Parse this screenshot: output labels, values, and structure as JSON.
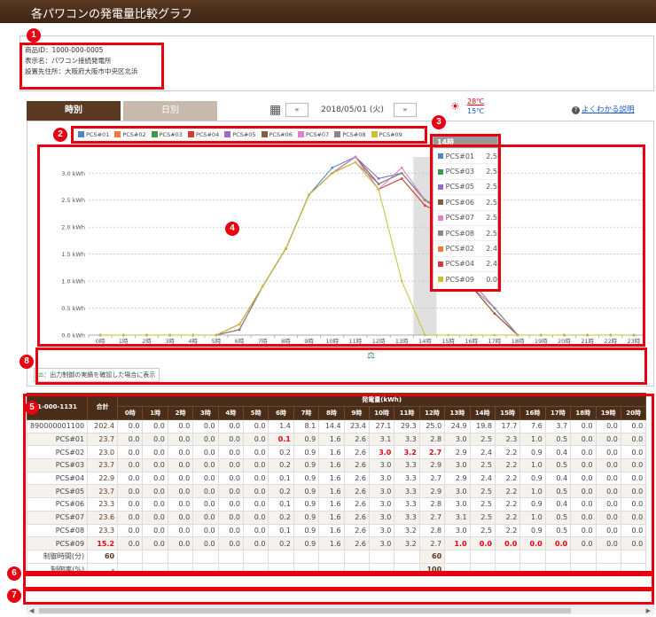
{
  "header": {
    "title": "各パワコンの発電量比較グラフ"
  },
  "info": {
    "product_id": "商品ID：1000-000-0005",
    "display_name": "表示名：パワコン接続発電所",
    "location": "設置先住所：大阪府大阪市中央区北浜"
  },
  "tabs": {
    "hourly": "時別",
    "daily": "日別"
  },
  "date_nav": {
    "prev": "«",
    "date": "2018/05/01 (火)",
    "next": "»"
  },
  "weather": {
    "high": "28℃",
    "low": "15℃",
    "icon": "sun-cloud-icon"
  },
  "help_link": "よくわかる説明",
  "badges": [
    "1",
    "2",
    "3",
    "4",
    "5",
    "6",
    "7",
    "8"
  ],
  "legend": [
    {
      "name": "PCS#01",
      "color": "#4a86c8"
    },
    {
      "name": "PCS#02",
      "color": "#f07a3a"
    },
    {
      "name": "PCS#03",
      "color": "#3a9a4a"
    },
    {
      "name": "PCS#04",
      "color": "#d43a3a"
    },
    {
      "name": "PCS#05",
      "color": "#9a6ac8"
    },
    {
      "name": "PCS#06",
      "color": "#8a5a3a"
    },
    {
      "name": "PCS#07",
      "color": "#e080c8"
    },
    {
      "name": "PCS#08",
      "color": "#888888"
    },
    {
      "name": "PCS#09",
      "color": "#c8c030"
    }
  ],
  "tooltip": {
    "title": "14時",
    "rows": [
      {
        "name": "PCS#01",
        "value": "2.5",
        "color": "#4a86c8"
      },
      {
        "name": "PCS#03",
        "value": "2.5",
        "color": "#3a9a4a"
      },
      {
        "name": "PCS#05",
        "value": "2.5",
        "color": "#9a6ac8"
      },
      {
        "name": "PCS#06",
        "value": "2.5",
        "color": "#8a5a3a"
      },
      {
        "name": "PCS#07",
        "value": "2.5",
        "color": "#e080c8"
      },
      {
        "name": "PCS#08",
        "value": "2.5",
        "color": "#888888"
      },
      {
        "name": "PCS#02",
        "value": "2.4",
        "color": "#f07a3a"
      },
      {
        "name": "PCS#04",
        "value": "2.4",
        "color": "#d43a3a"
      },
      {
        "name": "PCS#09",
        "value": "0.0",
        "color": "#c8c030"
      }
    ]
  },
  "chart_data": {
    "type": "line",
    "x": [
      "0時",
      "1時",
      "2時",
      "3時",
      "4時",
      "5時",
      "6時",
      "7時",
      "8時",
      "9時",
      "10時",
      "11時",
      "12時",
      "13時",
      "14時",
      "15時",
      "16時",
      "17時",
      "18時",
      "19時",
      "20時",
      "21時",
      "22時",
      "23時"
    ],
    "yticks": [
      "0.0 kWh",
      "0.5 kWh",
      "1.0 kWh",
      "1.5 kWh",
      "2.0 kWh",
      "2.5 kWh",
      "3.0 kWh"
    ],
    "ylim": [
      0,
      3.3
    ],
    "grid": true,
    "highlight_x": "14時",
    "series": [
      {
        "name": "PCS#01",
        "color": "#4a86c8",
        "values": [
          0,
          0,
          0,
          0,
          0,
          0,
          0.1,
          0.9,
          1.6,
          2.6,
          3.1,
          3.3,
          2.8,
          3.0,
          2.5,
          2.3,
          1.0,
          0.5,
          0,
          0,
          0,
          0,
          0,
          0
        ]
      },
      {
        "name": "PCS#02",
        "color": "#f07a3a",
        "values": [
          0,
          0,
          0,
          0,
          0,
          0,
          0.2,
          0.9,
          1.6,
          2.6,
          3.0,
          3.2,
          2.7,
          2.9,
          2.4,
          2.2,
          0.9,
          0.4,
          0,
          0,
          0,
          0,
          0,
          0
        ]
      },
      {
        "name": "PCS#03",
        "color": "#3a9a4a",
        "values": [
          0,
          0,
          0,
          0,
          0,
          0,
          0.2,
          0.9,
          1.6,
          2.6,
          3.0,
          3.3,
          2.9,
          3.0,
          2.5,
          2.2,
          1.0,
          0.5,
          0,
          0,
          0,
          0,
          0,
          0
        ]
      },
      {
        "name": "PCS#04",
        "color": "#d43a3a",
        "values": [
          0,
          0,
          0,
          0,
          0,
          0,
          0.1,
          0.9,
          1.6,
          2.6,
          3.0,
          3.3,
          2.7,
          2.9,
          2.4,
          2.2,
          0.9,
          0.4,
          0,
          0,
          0,
          0,
          0,
          0
        ]
      },
      {
        "name": "PCS#05",
        "color": "#9a6ac8",
        "values": [
          0,
          0,
          0,
          0,
          0,
          0,
          0.2,
          0.9,
          1.6,
          2.6,
          3.0,
          3.3,
          2.9,
          3.0,
          2.5,
          2.2,
          1.0,
          0.5,
          0,
          0,
          0,
          0,
          0,
          0
        ]
      },
      {
        "name": "PCS#06",
        "color": "#8a5a3a",
        "values": [
          0,
          0,
          0,
          0,
          0,
          0,
          0.1,
          0.9,
          1.6,
          2.6,
          3.0,
          3.3,
          2.8,
          3.0,
          2.5,
          2.2,
          0.9,
          0.4,
          0,
          0,
          0,
          0,
          0,
          0
        ]
      },
      {
        "name": "PCS#07",
        "color": "#e080c8",
        "values": [
          0,
          0,
          0,
          0,
          0,
          0,
          0.2,
          0.9,
          1.6,
          2.6,
          3.0,
          3.3,
          2.7,
          3.1,
          2.5,
          2.2,
          1.0,
          0.5,
          0,
          0,
          0,
          0,
          0,
          0
        ]
      },
      {
        "name": "PCS#08",
        "color": "#888888",
        "values": [
          0,
          0,
          0,
          0,
          0,
          0,
          0.1,
          0.9,
          1.6,
          2.6,
          3.0,
          3.2,
          2.8,
          3.0,
          2.5,
          2.2,
          0.9,
          0.5,
          0,
          0,
          0,
          0,
          0,
          0
        ]
      },
      {
        "name": "PCS#09",
        "color": "#c8c030",
        "values": [
          0,
          0,
          0,
          0,
          0,
          0,
          0.2,
          0.9,
          1.6,
          2.6,
          3.0,
          3.2,
          2.7,
          1.0,
          0,
          0,
          0,
          0,
          0,
          0,
          0,
          0,
          0,
          0
        ]
      }
    ]
  },
  "note": "：出力制御の実績を確認した場合に表示",
  "note_icon": "scale-icon",
  "table": {
    "id_header": "1-000-1131",
    "total_header": "合計",
    "group_header": "発電量(kWh)",
    "hours": [
      "0時",
      "1時",
      "2時",
      "3時",
      "4時",
      "5時",
      "6時",
      "7時",
      "8時",
      "9時",
      "10時",
      "11時",
      "12時",
      "13時",
      "14時",
      "15時",
      "16時",
      "17時",
      "18時",
      "19時",
      "20時"
    ],
    "rows": [
      {
        "name": "890000001100",
        "total": "202.4",
        "values": [
          "0.0",
          "0.0",
          "0.0",
          "0.0",
          "0.0",
          "0.0",
          "1.4",
          "8.1",
          "14.4",
          "23.4",
          "27.1",
          "29.3",
          "25.0",
          "24.9",
          "19.8",
          "17.7",
          "7.6",
          "3.7",
          "0.0",
          "0.0",
          "0.0"
        ],
        "red": []
      },
      {
        "name": "PCS#01",
        "total": "23.7",
        "values": [
          "0.0",
          "0.0",
          "0.0",
          "0.0",
          "0.0",
          "0.0",
          "0.1",
          "0.9",
          "1.6",
          "2.6",
          "3.1",
          "3.3",
          "2.8",
          "3.0",
          "2.5",
          "2.3",
          "1.0",
          "0.5",
          "0.0",
          "0.0",
          "0.0"
        ],
        "red": [
          6
        ]
      },
      {
        "name": "PCS#02",
        "total": "23.0",
        "values": [
          "0.0",
          "0.0",
          "0.0",
          "0.0",
          "0.0",
          "0.0",
          "0.2",
          "0.9",
          "1.6",
          "2.6",
          "3.0",
          "3.2",
          "2.7",
          "2.9",
          "2.4",
          "2.2",
          "0.9",
          "0.4",
          "0.0",
          "0.0",
          "0.0"
        ],
        "red": [
          10,
          11,
          12
        ]
      },
      {
        "name": "PCS#03",
        "total": "23.7",
        "values": [
          "0.0",
          "0.0",
          "0.0",
          "0.0",
          "0.0",
          "0.0",
          "0.2",
          "0.9",
          "1.6",
          "2.6",
          "3.0",
          "3.3",
          "2.9",
          "3.0",
          "2.5",
          "2.2",
          "1.0",
          "0.5",
          "0.0",
          "0.0",
          "0.0"
        ],
        "red": []
      },
      {
        "name": "PCS#04",
        "total": "22.9",
        "values": [
          "0.0",
          "0.0",
          "0.0",
          "0.0",
          "0.0",
          "0.0",
          "0.1",
          "0.9",
          "1.6",
          "2.6",
          "3.0",
          "3.3",
          "2.7",
          "2.9",
          "2.4",
          "2.2",
          "0.9",
          "0.4",
          "0.0",
          "0.0",
          "0.0"
        ],
        "red": []
      },
      {
        "name": "PCS#05",
        "total": "23.7",
        "values": [
          "0.0",
          "0.0",
          "0.0",
          "0.0",
          "0.0",
          "0.0",
          "0.2",
          "0.9",
          "1.6",
          "2.6",
          "3.0",
          "3.3",
          "2.9",
          "3.0",
          "2.5",
          "2.2",
          "1.0",
          "0.5",
          "0.0",
          "0.0",
          "0.0"
        ],
        "red": []
      },
      {
        "name": "PCS#06",
        "total": "23.3",
        "values": [
          "0.0",
          "0.0",
          "0.0",
          "0.0",
          "0.0",
          "0.0",
          "0.1",
          "0.9",
          "1.6",
          "2.6",
          "3.0",
          "3.3",
          "2.8",
          "3.0",
          "2.5",
          "2.2",
          "0.9",
          "0.4",
          "0.0",
          "0.0",
          "0.0"
        ],
        "red": []
      },
      {
        "name": "PCS#07",
        "total": "23.6",
        "values": [
          "0.0",
          "0.0",
          "0.0",
          "0.0",
          "0.0",
          "0.0",
          "0.2",
          "0.9",
          "1.6",
          "2.6",
          "3.0",
          "3.3",
          "2.7",
          "3.1",
          "2.5",
          "2.2",
          "1.0",
          "0.5",
          "0.0",
          "0.0",
          "0.0"
        ],
        "red": []
      },
      {
        "name": "PCS#08",
        "total": "23.3",
        "values": [
          "0.0",
          "0.0",
          "0.0",
          "0.0",
          "0.0",
          "0.0",
          "0.1",
          "0.9",
          "1.6",
          "2.6",
          "3.0",
          "3.2",
          "2.8",
          "3.0",
          "2.5",
          "2.2",
          "0.9",
          "0.5",
          "0.0",
          "0.0",
          "0.0"
        ],
        "red": []
      },
      {
        "name": "PCS#09",
        "total": "15.2",
        "total_red": true,
        "values": [
          "0.0",
          "0.0",
          "0.0",
          "0.0",
          "0.0",
          "0.0",
          "0.2",
          "0.9",
          "1.6",
          "2.6",
          "3.0",
          "3.2",
          "2.7",
          "1.0",
          "0.0",
          "0.0",
          "0.0",
          "0.0",
          "0.0",
          "0.0",
          "0.0"
        ],
        "red": [
          13,
          14,
          15,
          16,
          17
        ]
      }
    ],
    "control_time": {
      "label": "制御時間(分)",
      "total": "60",
      "values": [
        "",
        "",
        "",
        "",
        "",
        "",
        "",
        "",
        "",
        "",
        "",
        "",
        "60",
        "",
        "",
        "",
        "",
        "",
        "",
        "",
        ""
      ]
    },
    "control_rate": {
      "label": "制御率(%)",
      "total": "-",
      "values": [
        "",
        "",
        "",
        "",
        "",
        "",
        "",
        "",
        "",
        "",
        "",
        "",
        "100",
        "",
        "",
        "",
        "",
        "",
        "",
        "",
        ""
      ]
    }
  }
}
